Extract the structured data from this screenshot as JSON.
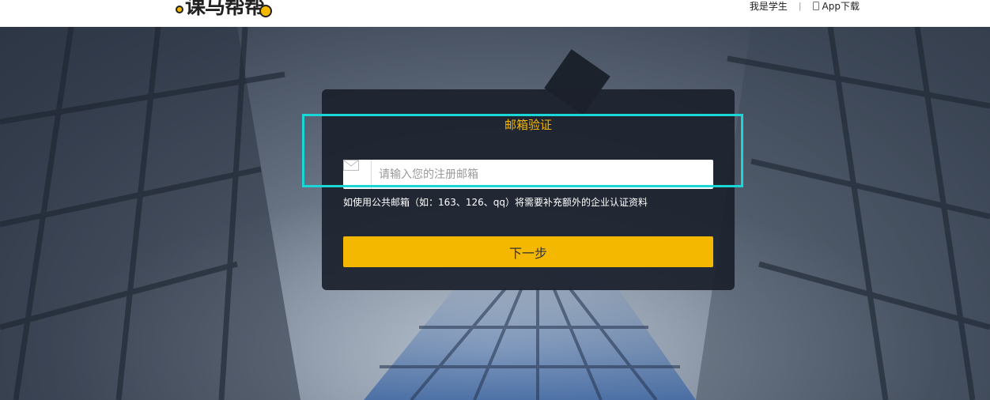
{
  "header": {
    "logo_text": "课马帮帮",
    "nav": {
      "student_link": "我是学生",
      "separator": "|",
      "app_download": "App下载",
      "app_icon": "phone-icon"
    }
  },
  "card": {
    "title": "邮箱验证",
    "email_field": {
      "icon": "mail-icon",
      "placeholder": "请输入您的注册邮箱",
      "value": ""
    },
    "hint": "如使用公共邮箱（如：163、126、qq）将需要补充额外的企业认证资料",
    "next_button": "下一步"
  },
  "colors": {
    "accent": "#f5b800",
    "card_bg": "#1b202c",
    "highlight_border": "#1ad6d6"
  }
}
